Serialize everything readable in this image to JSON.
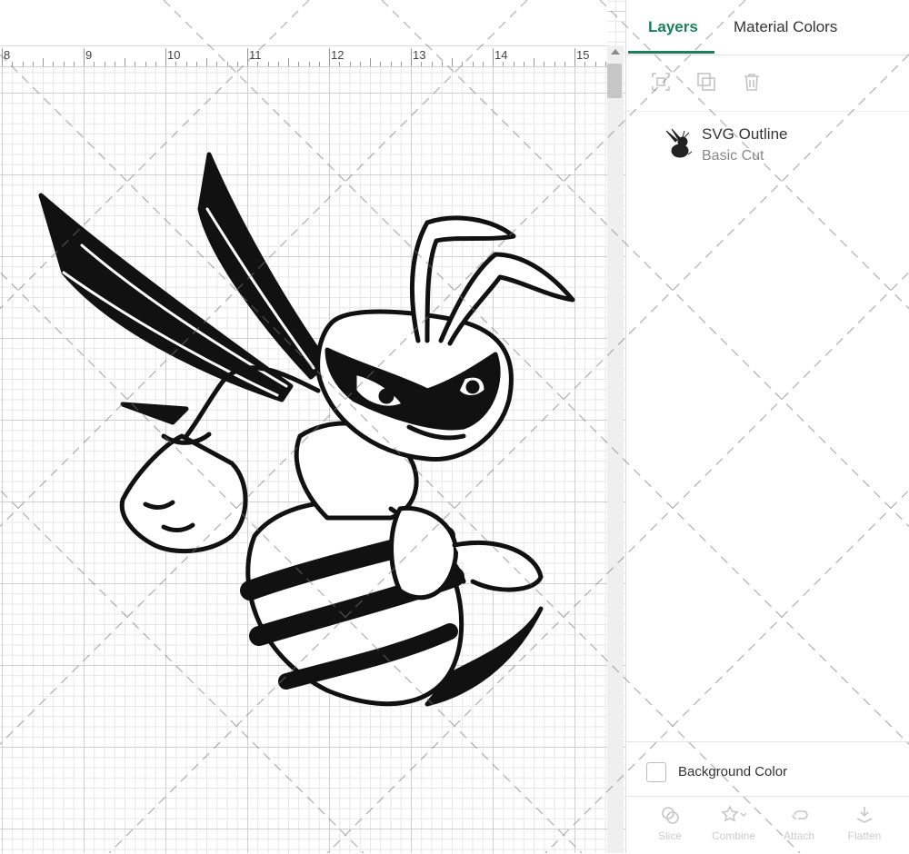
{
  "ruler": {
    "numbers": [
      "8",
      "9",
      "10",
      "11",
      "12",
      "13",
      "14",
      "15"
    ]
  },
  "tabs": {
    "layers": "Layers",
    "material_colors": "Material Colors"
  },
  "toolbar": {
    "icons": [
      "group-icon",
      "duplicate-icon",
      "delete-icon"
    ]
  },
  "layer": {
    "name": "SVG Outline",
    "operation": "Basic Cut"
  },
  "background": {
    "label": "Background Color",
    "checked": false
  },
  "bottom_tools": [
    "Slice",
    "Combine",
    "Attach",
    "Flatten"
  ],
  "colors": {
    "accent": "#1a7f5a",
    "artwork": "#111111"
  }
}
